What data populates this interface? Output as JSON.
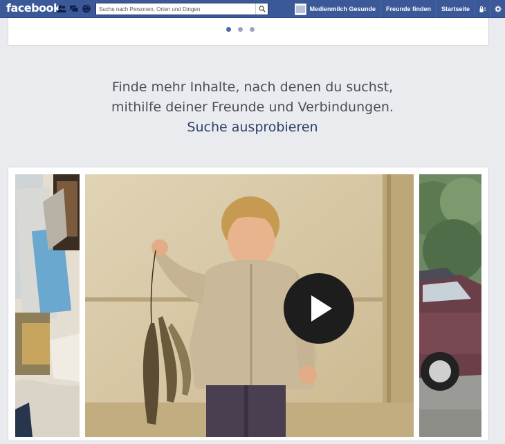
{
  "topbar": {
    "logo": "facebook",
    "jewels": [
      "friend-requests-icon",
      "messages-icon",
      "notifications-icon"
    ],
    "search": {
      "placeholder": "Suche nach Personen, Orten und Dingen"
    },
    "nav": {
      "profile_name": "Medienmilch Gesunde",
      "find_friends": "Freunde finden",
      "home": "Startseite"
    },
    "icons": [
      "privacy-shortcuts-icon",
      "settings-gear-icon"
    ]
  },
  "carousel": {
    "dot_count": 3,
    "active_index": 0
  },
  "promo": {
    "line1": "Finde mehr Inhalte, nach denen du suchst,",
    "line2": "mithilfe deiner Freunde und Verbindungen.",
    "link": "Suche ausprobieren"
  },
  "video": {
    "play_icon": "play-icon"
  },
  "colors": {
    "brand": "#3b5998",
    "background": "#e9ebee",
    "link": "#2b3f6b",
    "active_dot": "#4e69a2"
  }
}
